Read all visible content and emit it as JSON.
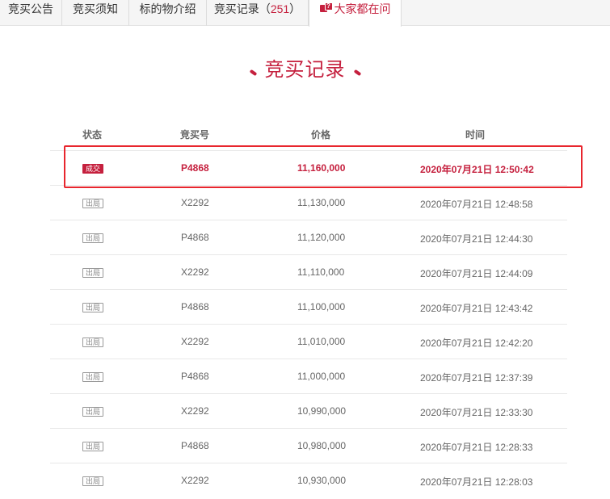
{
  "tabs": [
    {
      "label": "竞买公告"
    },
    {
      "label": "竞买须知"
    },
    {
      "label": "标的物介绍"
    },
    {
      "label": "竞买记录（",
      "count": "251",
      "suffix": "）"
    },
    {
      "label": "大家都在问",
      "icon": "qa-icon"
    }
  ],
  "heading": {
    "title": "竞买记录"
  },
  "table": {
    "headers": {
      "status": "状态",
      "bidder_no": "竞买号",
      "price": "价格",
      "time": "时间"
    },
    "rows": [
      {
        "status": "成交",
        "bidder_no": "P4868",
        "price": "11,160,000",
        "time": "2020年07月21日 12:50:42"
      },
      {
        "status": "出局",
        "bidder_no": "X2292",
        "price": "11,130,000",
        "time": "2020年07月21日 12:48:58"
      },
      {
        "status": "出局",
        "bidder_no": "P4868",
        "price": "11,120,000",
        "time": "2020年07月21日 12:44:30"
      },
      {
        "status": "出局",
        "bidder_no": "X2292",
        "price": "11,110,000",
        "time": "2020年07月21日 12:44:09"
      },
      {
        "status": "出局",
        "bidder_no": "P4868",
        "price": "11,100,000",
        "time": "2020年07月21日 12:43:42"
      },
      {
        "status": "出局",
        "bidder_no": "X2292",
        "price": "11,010,000",
        "time": "2020年07月21日 12:42:20"
      },
      {
        "status": "出局",
        "bidder_no": "P4868",
        "price": "11,000,000",
        "time": "2020年07月21日 12:37:39"
      },
      {
        "status": "出局",
        "bidder_no": "X2292",
        "price": "10,990,000",
        "time": "2020年07月21日 12:33:30"
      },
      {
        "status": "出局",
        "bidder_no": "P4868",
        "price": "10,980,000",
        "time": "2020年07月21日 12:28:33"
      },
      {
        "status": "出局",
        "bidder_no": "X2292",
        "price": "10,930,000",
        "time": "2020年07月21日 12:28:03"
      }
    ]
  },
  "colors": {
    "accent": "#c5203e",
    "highlight_border": "#e8262e"
  }
}
